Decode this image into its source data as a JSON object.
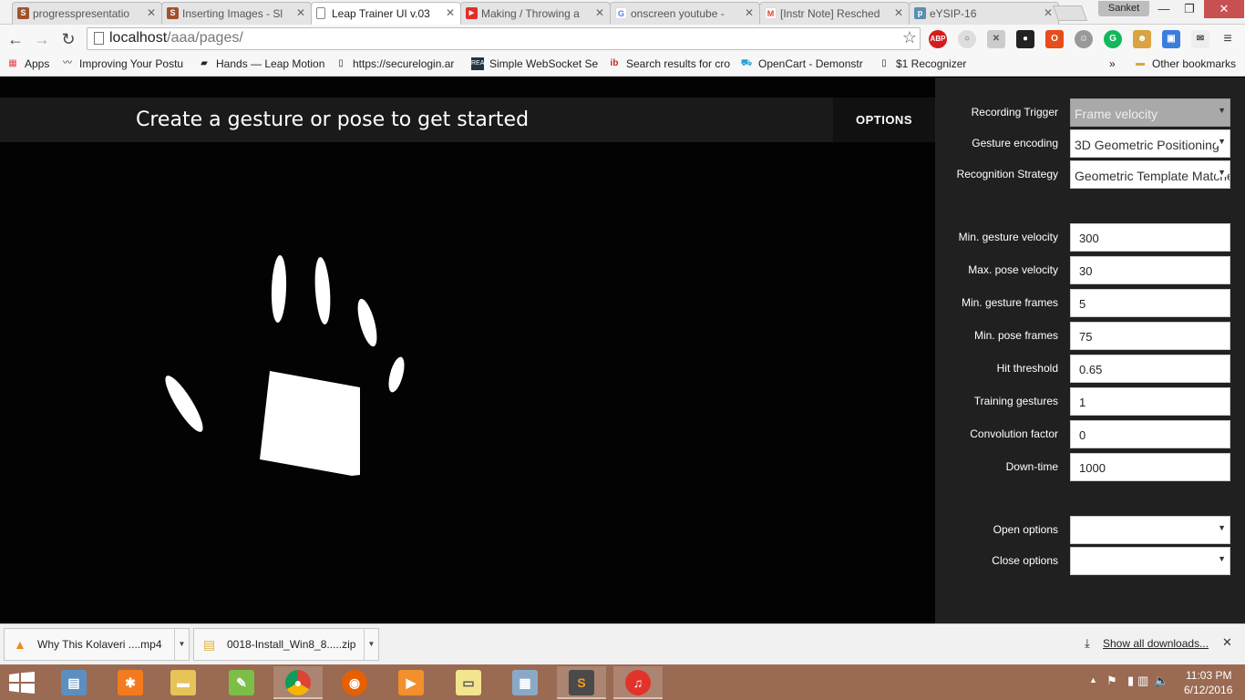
{
  "browser": {
    "tabs": [
      {
        "label": "progresspresentatio",
        "icon": "slides-s-icon",
        "color": "#a0522d",
        "letter": "S"
      },
      {
        "label": "Inserting Images - Sl",
        "icon": "slides-s-icon",
        "color": "#a0522d",
        "letter": "S"
      },
      {
        "label": "Leap Trainer UI v.03",
        "icon": "page-icon",
        "color": "#ffffff",
        "letter": ""
      },
      {
        "label": "Making / Throwing a",
        "icon": "youtube-icon",
        "color": "#e52d27",
        "letter": "▶"
      },
      {
        "label": "onscreen youtube -",
        "icon": "google-icon",
        "color": "#4285f4",
        "letter": "G"
      },
      {
        "label": "[Instr Note] Resched",
        "icon": "gmail-icon",
        "color": "#d14836",
        "letter": "M"
      },
      {
        "label": "eYSIP-16",
        "icon": "pbworks-icon",
        "color": "#5a8fb0",
        "letter": "p"
      }
    ],
    "profile": "Sanket",
    "url_host": "localhost",
    "url_path": "/aaa/pages/",
    "bookmarks": [
      {
        "label": "Apps",
        "icon": "apps-grid-icon"
      },
      {
        "label": "Improving Your Postu",
        "icon": "mustache-icon"
      },
      {
        "label": "Hands — Leap Motion",
        "icon": "leap-icon"
      },
      {
        "label": "https://securelogin.ar",
        "icon": "page-icon"
      },
      {
        "label": "Simple WebSocket Se",
        "icon": "rea-icon"
      },
      {
        "label": "Search results for cro",
        "icon": "ib-icon"
      },
      {
        "label": "OpenCart - Demonstr",
        "icon": "cart-icon"
      },
      {
        "label": "$1 Recognizer",
        "icon": "page-icon"
      }
    ],
    "other_bookmarks": "Other bookmarks",
    "overflow": "»"
  },
  "page": {
    "title": "Create a gesture or pose to get started",
    "options_label": "OPTIONS"
  },
  "options": {
    "recording_trigger": {
      "label": "Recording Trigger",
      "value": "Frame velocity"
    },
    "gesture_encoding": {
      "label": "Gesture encoding",
      "value": "3D Geometric Positioning"
    },
    "recognition_strategy": {
      "label": "Recognition Strategy",
      "value": "Geometric Template Matcher"
    },
    "min_gesture_velocity": {
      "label": "Min. gesture velocity",
      "value": "300"
    },
    "max_pose_velocity": {
      "label": "Max. pose velocity",
      "value": "30"
    },
    "min_gesture_frames": {
      "label": "Min. gesture frames",
      "value": "5"
    },
    "min_pose_frames": {
      "label": "Min. pose frames",
      "value": "75"
    },
    "hit_threshold": {
      "label": "Hit threshold",
      "value": "0.65"
    },
    "training_gestures": {
      "label": "Training gestures",
      "value": "1"
    },
    "convolution_factor": {
      "label": "Convolution factor",
      "value": "0"
    },
    "down_time": {
      "label": "Down-time",
      "value": "1000"
    },
    "open_options": {
      "label": "Open options",
      "value": ""
    },
    "close_options": {
      "label": "Close options",
      "value": ""
    }
  },
  "downloads": {
    "items": [
      {
        "name": "Why This Kolaveri ....mp4",
        "icon": "vlc-cone-icon"
      },
      {
        "name": "0018-Install_Win8_8.....zip",
        "icon": "zip-file-icon"
      }
    ],
    "show_all": "Show all downloads...",
    "close": "✕"
  },
  "taskbar": {
    "time": "11:03 PM",
    "date": "6/12/2016"
  },
  "colors": {
    "page_bg": "#030303",
    "panel_bg": "#202020",
    "header_bar": "#1a1a1a",
    "taskbar": "#9a6a53"
  }
}
